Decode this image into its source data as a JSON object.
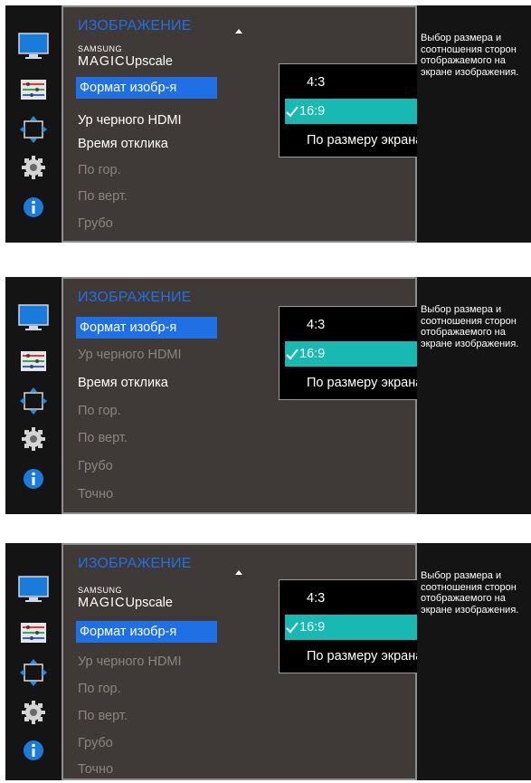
{
  "screens": [
    {
      "title": "ИЗОБРАЖЕНИЕ",
      "magic": {
        "brand_top": "SAMSUNG",
        "brand_bottom": "MAGIC",
        "label": "Upscale"
      },
      "items": {
        "format": "Формат изобр-я",
        "black_hdmi": "Ур черного HDMI",
        "response_time": "Время отклика",
        "h_pos": "По гор.",
        "v_pos": "По верт.",
        "coarse": "Грубо"
      },
      "dropdown": {
        "opt1": "4:3",
        "opt2": "16:9",
        "opt3": "По размеру экрана",
        "selected": "16:9"
      },
      "help": "Выбор размера и соотношения сторон отображаемого на экране изображения."
    },
    {
      "title": "ИЗОБРАЖЕНИЕ",
      "items": {
        "format": "Формат изобр-я",
        "black_hdmi": "Ур черного HDMI",
        "response_time": "Время отклика",
        "h_pos": "По гор.",
        "v_pos": "По верт.",
        "coarse": "Грубо",
        "fine": "Точно"
      },
      "dropdown": {
        "opt1": "4:3",
        "opt2": "16:9",
        "opt3": "По размеру экрана",
        "selected": "16:9"
      },
      "help": "Выбор размера и соотношения сторон отображаемого на экране изображения."
    },
    {
      "title": "ИЗОБРАЖЕНИЕ",
      "magic": {
        "brand_top": "SAMSUNG",
        "brand_bottom": "MAGIC",
        "label": "Upscale"
      },
      "items": {
        "format": "Формат изобр-я",
        "black_hdmi": "Ур черного HDMI",
        "h_pos": "По гор.",
        "v_pos": "По верт.",
        "coarse": "Грубо",
        "fine": "Точно"
      },
      "dropdown": {
        "opt1": "4:3",
        "opt2": "16:9",
        "opt3": "По размеру экрана",
        "selected": "16:9"
      },
      "help": "Выбор размера и соотношения сторон отображаемого на экране изображения."
    }
  ],
  "icons": [
    "picture-icon",
    "color-icon",
    "size-position-icon",
    "setup-icon",
    "info-icon"
  ],
  "colors": {
    "accent_blue": "#1f6fe5",
    "selected_teal": "#18b8b3",
    "panel": "#3f3a37",
    "frame": "#141414"
  }
}
